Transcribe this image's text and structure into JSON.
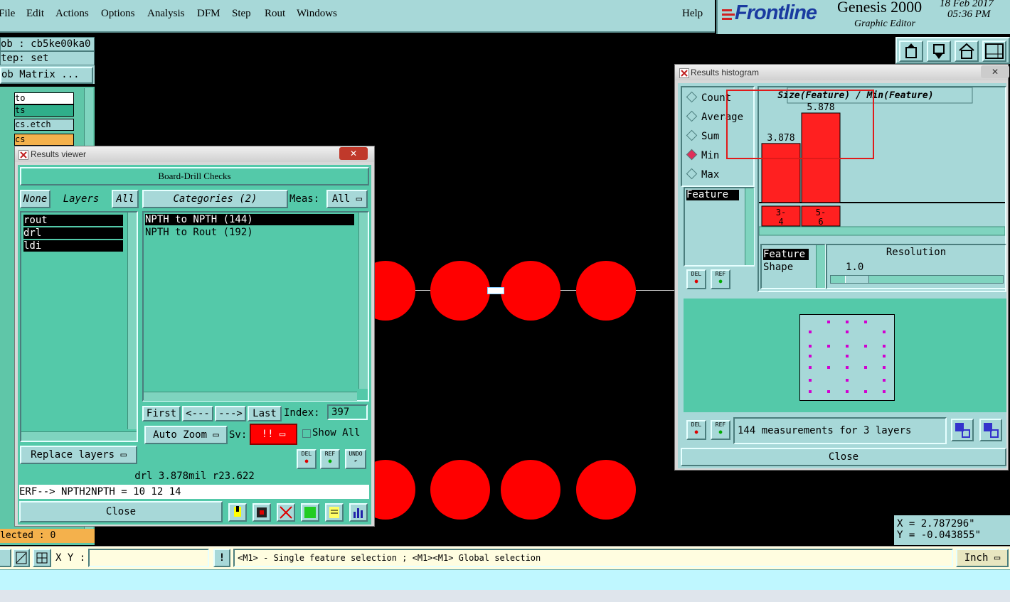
{
  "menu": [
    "File",
    "Edit",
    "Actions",
    "Options",
    "Analysis",
    "DFM",
    "Step",
    "Rout",
    "Windows"
  ],
  "help": "Help",
  "brand": {
    "logo": "Frontline",
    "product": "Genesis 2000",
    "subtitle": "Graphic Editor",
    "date": "18 Feb 2017",
    "time": "05:36 PM"
  },
  "job_panel": {
    "job": "ob : cb5ke00ka0",
    "step": "tep: set",
    "matrix_button": "ob Matrix ...",
    "layers": [
      "to",
      "ts",
      "cs.etch",
      "cs"
    ],
    "selected": "lected : 0"
  },
  "results_viewer": {
    "title": "Results viewer",
    "header": "Board-Drill Checks",
    "none_btn": "None",
    "layers_label": "Layers",
    "all_btn": "All",
    "layers": [
      "rout",
      "drl",
      "ldi"
    ],
    "categories_label": "Categories (2)",
    "meas_label": "Meas:",
    "meas_value": "All",
    "categories": [
      "NPTH to NPTH  (144)",
      "NPTH to Rout  (192)"
    ],
    "first": "First",
    "prev": "<---",
    "next": "--->",
    "last": "Last",
    "index_label": "Index:",
    "index_value": "397",
    "auto_zoom": "Auto Zoom",
    "sv_label": "Sv:",
    "sv_value": "!!",
    "show_all": "Show All",
    "replace_layers": "Replace layers",
    "del": "DEL",
    "ref": "REF",
    "undo": "UNDO",
    "status": "drl 3.878mil  r23.622",
    "erf": "ERF--> NPTH2NPTH = 10 12 14",
    "close": "Close"
  },
  "histogram": {
    "title": "Results histogram",
    "options": [
      "Count",
      "Average",
      "Sum",
      "Min",
      "Max"
    ],
    "selected_option": "Min",
    "chart_title": "Size(Feature) / Min(Feature)",
    "feature_list": [
      "Feature"
    ],
    "param_list": [
      "Feature",
      "Shape"
    ],
    "resolution_label": "Resolution",
    "resolution_value": "1.0",
    "del": "DEL",
    "ref": "REF",
    "summary": "144 measurements for 3 layers",
    "close": "Close"
  },
  "chart_data": {
    "type": "bar",
    "title": "Size(Feature) / Min(Feature)",
    "categories": [
      "3-4",
      "5-6"
    ],
    "category_lines": [
      [
        "3-",
        "4"
      ],
      [
        "5-",
        "6"
      ]
    ],
    "values": [
      3.878,
      5.878
    ],
    "value_labels": [
      "3.878",
      "5.878"
    ],
    "bar_color": "#ff2020"
  },
  "coords": {
    "x": "X = 2.787296\"",
    "y": "Y = -0.043855\""
  },
  "bottom": {
    "xy_label": "X Y :",
    "xy_value": "",
    "hint": "<M1> - Single feature selection ; <M1><M1> Global selection",
    "units": "Inch"
  }
}
